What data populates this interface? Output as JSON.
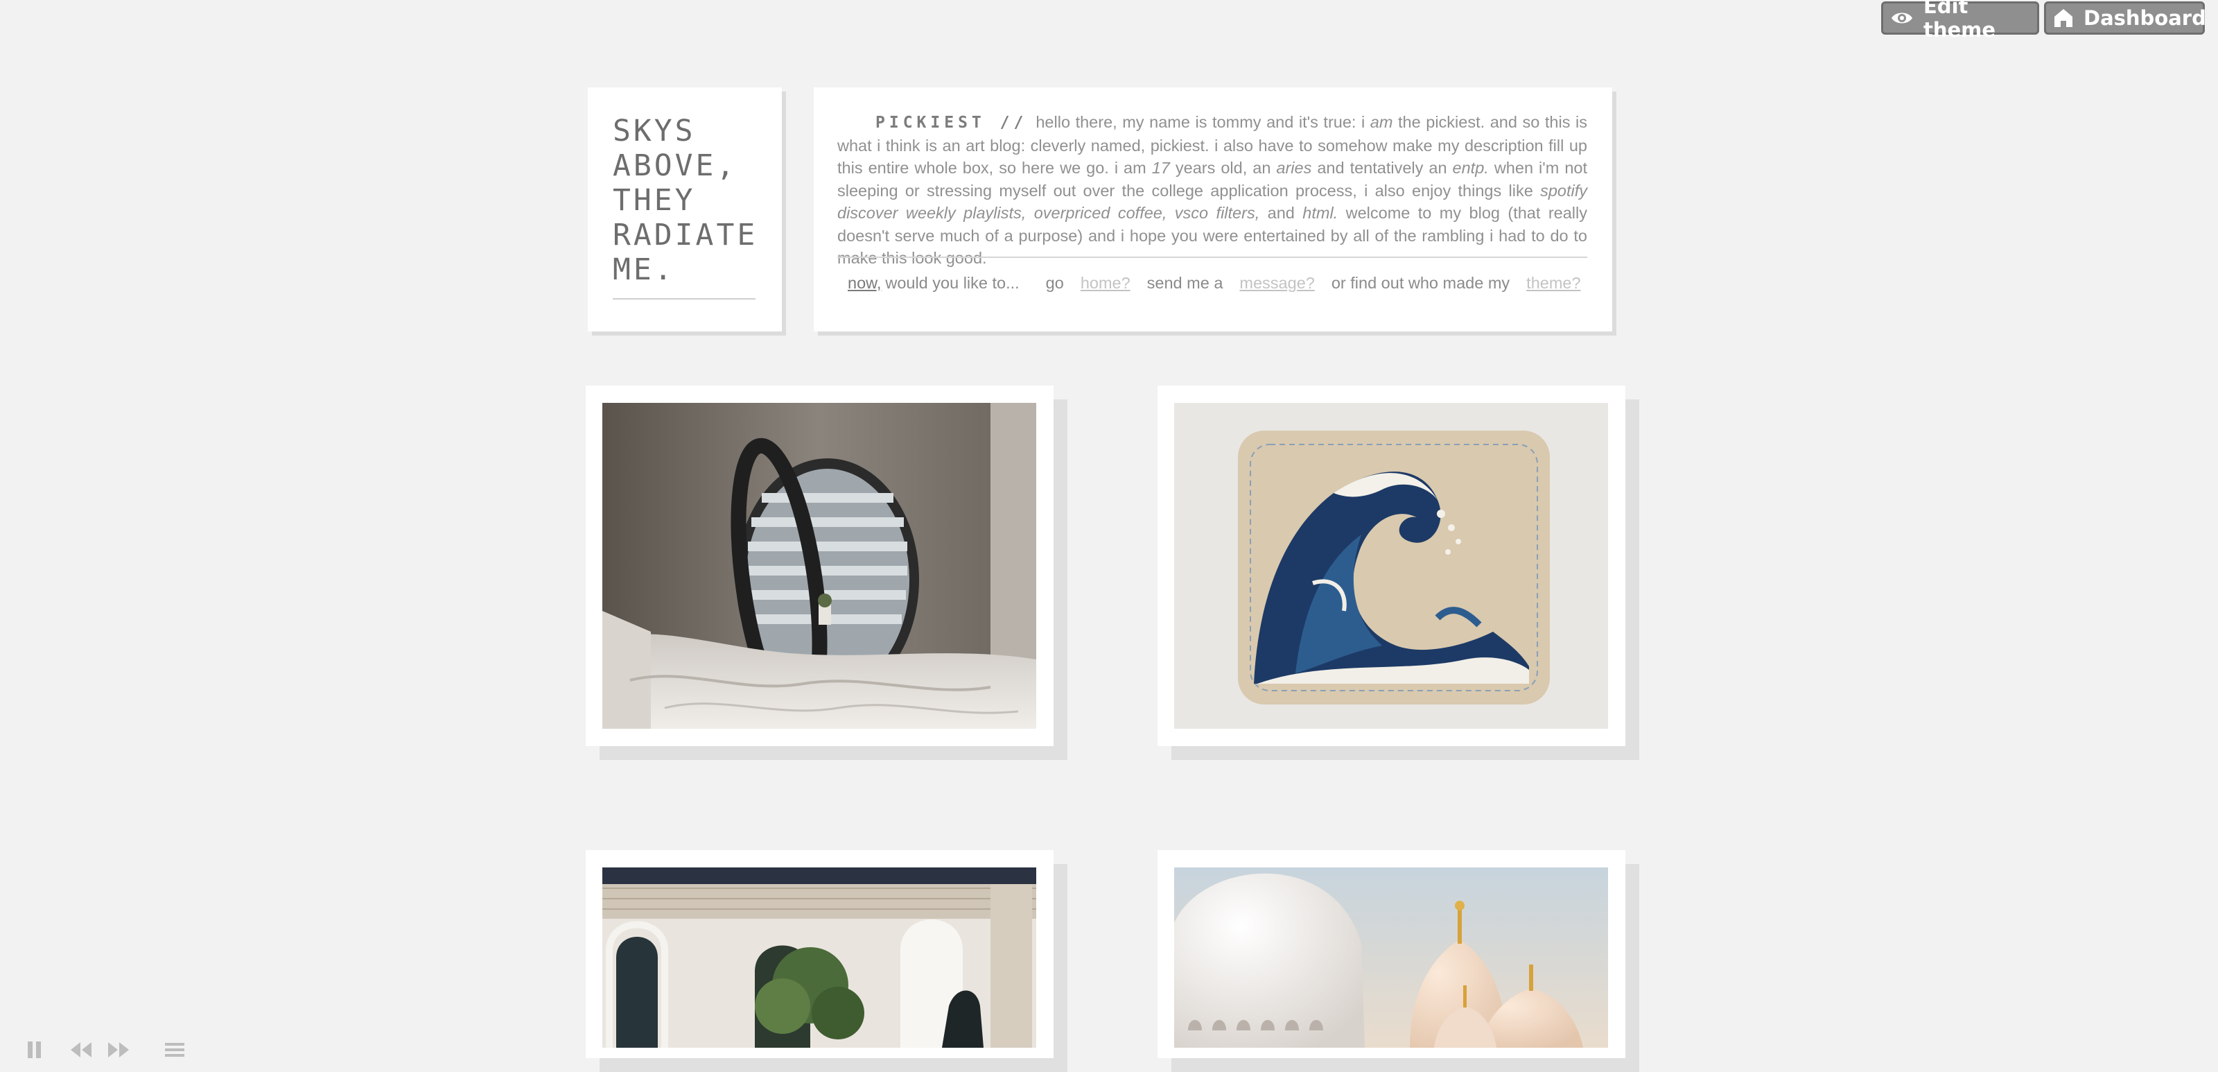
{
  "topbar": {
    "edit_label": "Edit theme",
    "dashboard_label": "Dashboard",
    "edit_icon": "eye-icon",
    "dashboard_icon": "home-icon"
  },
  "blog": {
    "title": "SKYS\nABOVE,\nTHEY\nRADIATE\nME.",
    "brand": "PICKIEST //",
    "desc": {
      "p1": "hello there, my name is tommy and it's true: i ",
      "am": "am",
      "p2": " the pickiest. and so this is what i think is an art blog: cleverly named, pickiest. i also have to somehow make my description fill up this entire whole box, so here we go. i am ",
      "age": "17",
      "p3": " years old, an ",
      "sign": "aries",
      "p4": " and tentatively an ",
      "type": "entp.",
      "p5": " when i'm not sleeping or stressing myself out over the college application process, i also enjoy things like ",
      "likes": "spotify discover weekly playlists, overpriced coffee, vsco filters,",
      "p6": " and ",
      "html": "html.",
      "p7": " welcome to my blog (that really doesn't serve much of a purpose) and i hope you were entertained by all of the rambling i had to do to make this look good."
    }
  },
  "nav": {
    "now": "now,",
    "like": " would you like to...",
    "go": "go",
    "home": "home?",
    "send": "send me a",
    "message": "message?",
    "find": "or find out who made my",
    "theme": "theme?"
  },
  "colors": {
    "background": "#f2f2f2",
    "button": "#8f8f8f"
  },
  "player": {
    "icons": [
      "pause-icon",
      "rewind-icon",
      "fast-forward-icon",
      "playlist-icon"
    ]
  }
}
